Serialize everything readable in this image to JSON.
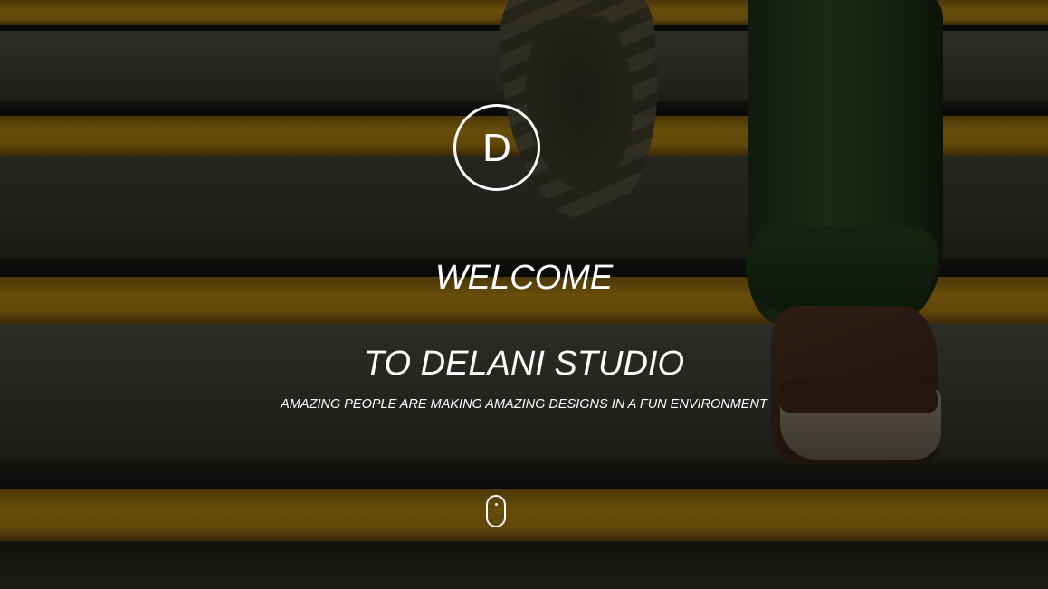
{
  "hero": {
    "logo_letter": "D",
    "title_line1": "WELCOME",
    "title_line2": "TO DELANI STUDIO",
    "tagline": "AMAZING PEOPLE ARE MAKING AMAZING DESIGNS IN A FUN ENVIRONMENT",
    "scroll_icon": "mouse-scroll-icon"
  },
  "colors": {
    "text": "#ffffff",
    "stripe_yellow": "#a87c10",
    "step_gray": "#3c3c34",
    "overlay": "rgba(0,0,0,0.38)"
  }
}
